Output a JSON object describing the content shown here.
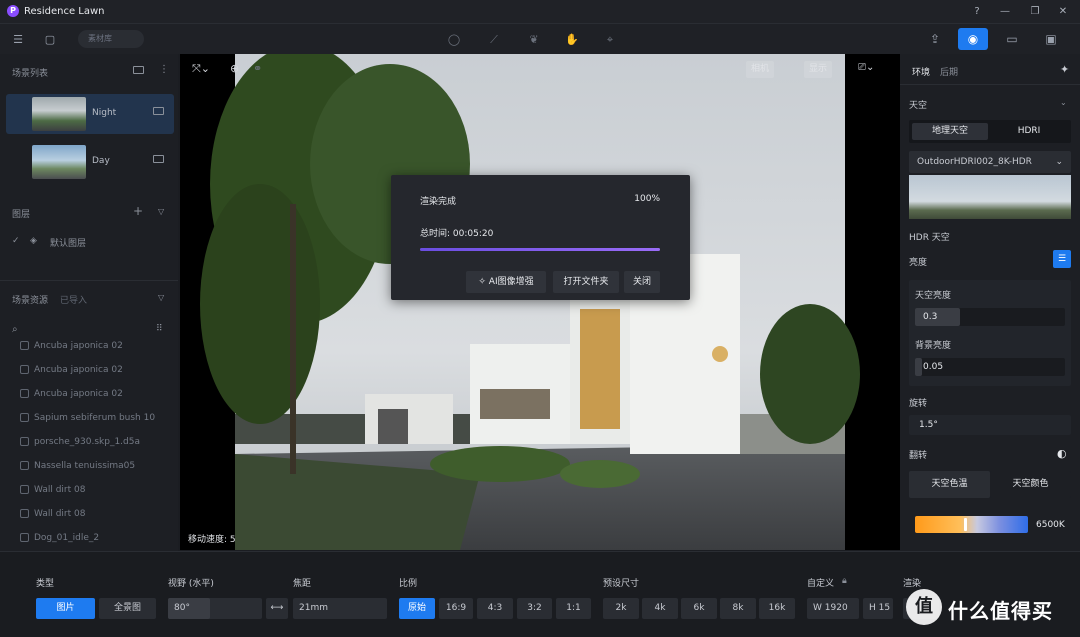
{
  "app": {
    "logo_letter": "P",
    "title": "Residence Lawn"
  },
  "window": {
    "help": "?",
    "minimize": "—",
    "restore": "❐",
    "close": "✕"
  },
  "toolbar": {
    "search_label": "素材库"
  },
  "left": {
    "scene_list_title": "场景列表",
    "scenes": [
      {
        "name": "Night"
      },
      {
        "name": "Day"
      }
    ],
    "layers_title": "图层",
    "layer_default": "默认图层",
    "assets_title": "场景资源",
    "assets_imported": "已导入",
    "assets": [
      "Ancuba japonica 02",
      "Ancuba japonica 02",
      "Ancuba japonica 02",
      "Sapium sebiferum bush 10",
      "porsche_930.skp_1.d5a",
      "Nassella tenuissima05",
      "Wall dirt 08",
      "Wall dirt 08",
      "Dog_01_idle_2"
    ]
  },
  "viewport": {
    "camera_btn": "相机",
    "display_btn": "显示",
    "move_speed": "移动速度: 5"
  },
  "dialog": {
    "status": "渲染完成",
    "percent": "100%",
    "progress": 1.0,
    "total_time": "总时间:  00:05:20",
    "ai_enhance": "AI图像增强",
    "open_folder": "打开文件夹",
    "close": "关闭"
  },
  "right": {
    "tab_env": "环境",
    "tab_post": "后期",
    "sky_title": "天空",
    "sky_tab_geo": "地理天空",
    "sky_tab_hdri": "HDRI",
    "hdri_select": "OutdoorHDRI002_8K-HDR",
    "hdr_sky": "HDR 天空",
    "brightness": "亮度",
    "sky_brightness": "天空亮度",
    "sky_brightness_value": "0.3",
    "bg_brightness": "背景亮度",
    "bg_brightness_value": "0.05",
    "rotation": "旋转",
    "rotation_value": "1.5°",
    "flip": "翻转",
    "sky_color_temp": "天空色温",
    "sky_color": "天空颜色",
    "temp_value": "6500K"
  },
  "bottom": {
    "type_label": "类型",
    "type_image": "图片",
    "type_pano": "全景图",
    "fov_label": "视野 (水平)",
    "fov_value": "80°",
    "focal_label": "焦距",
    "focal_value": "21mm",
    "ratio_label": "比例",
    "ratios": [
      "原始",
      "16:9",
      "4:3",
      "3:2",
      "1:1"
    ],
    "preset_label": "预设尺寸",
    "presets": [
      "2k",
      "4k",
      "6k",
      "8k",
      "16k"
    ],
    "custom_label": "自定义",
    "width_value": "W  1920",
    "height_value": "H  15",
    "render_label": "渲染"
  },
  "watermark": {
    "text": "什么值得买",
    "badge": "值"
  },
  "colors": {
    "accent": "#1e7bf0",
    "progress": "#8a5cf6",
    "bg": "#1b1d22"
  }
}
